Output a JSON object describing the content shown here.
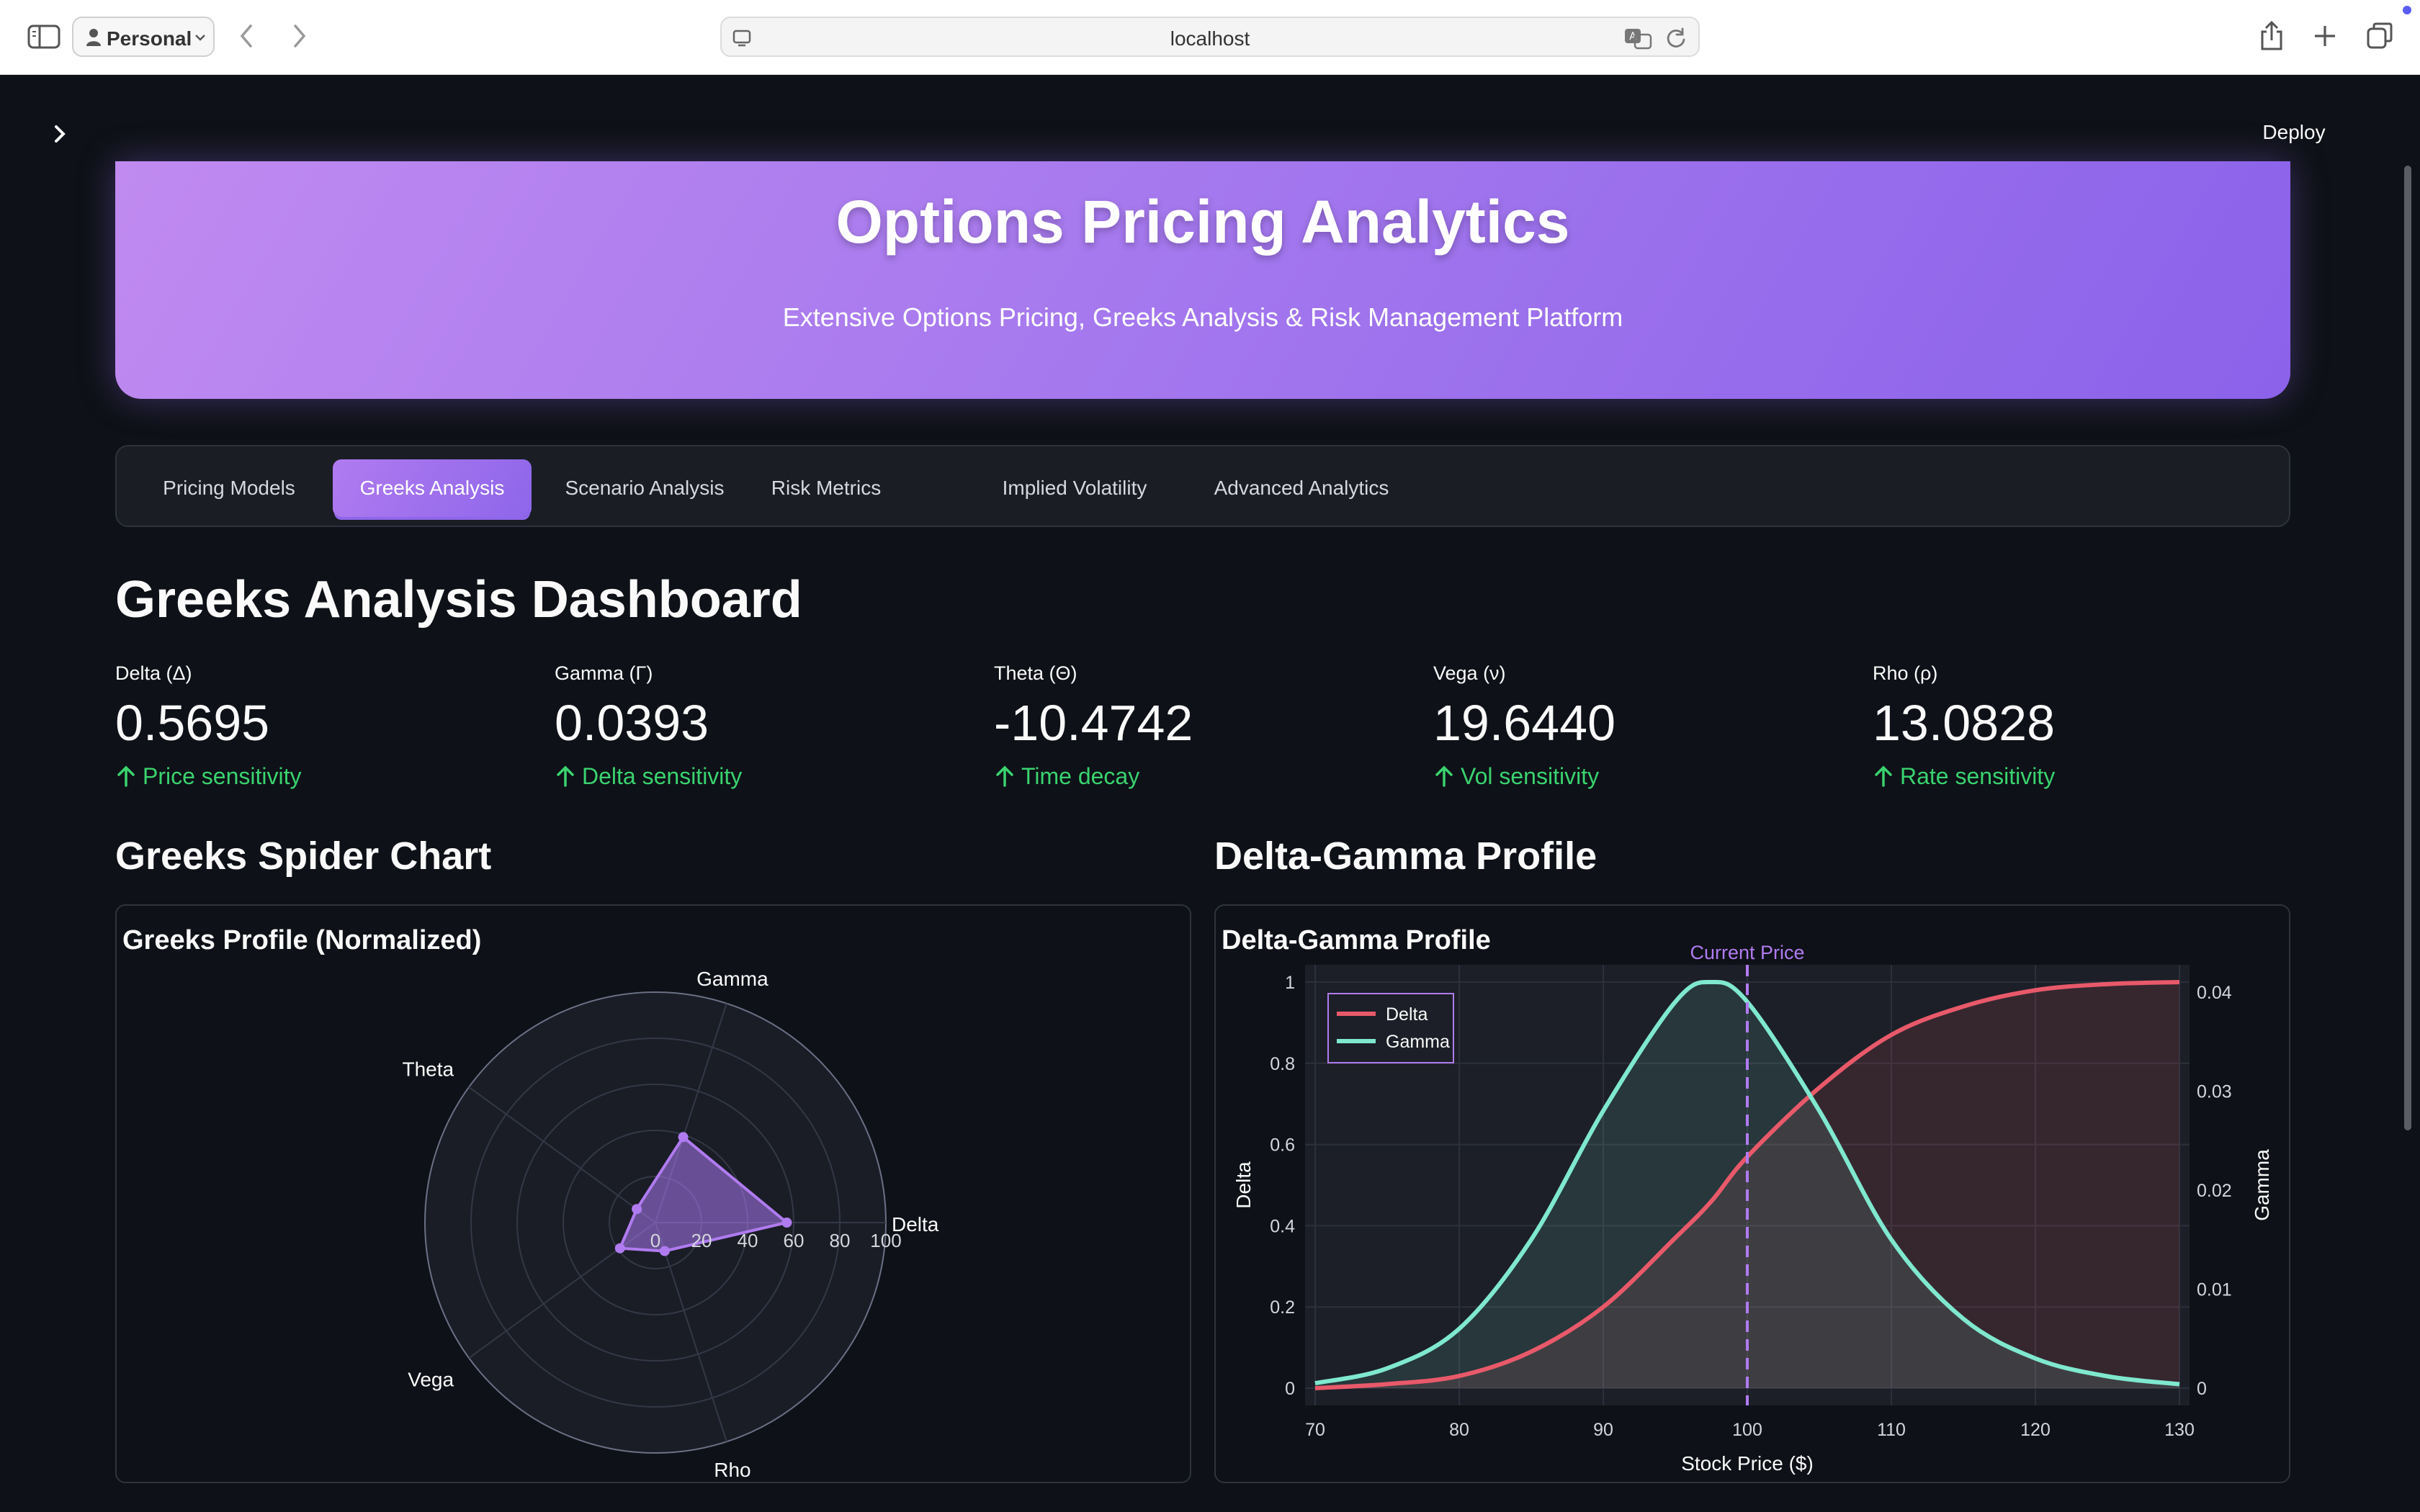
{
  "browser": {
    "profile_label": "Personal",
    "url": "localhost"
  },
  "app": {
    "deploy_label": "Deploy"
  },
  "hero": {
    "title": "Options Pricing Analytics",
    "subtitle": "Extensive Options Pricing, Greeks Analysis & Risk Management Platform"
  },
  "tabs": [
    {
      "label": "Pricing Models"
    },
    {
      "label": "Greeks Analysis"
    },
    {
      "label": "Scenario Analysis"
    },
    {
      "label": "Risk Metrics"
    },
    {
      "label": "Implied Volatility"
    },
    {
      "label": "Advanced Analytics"
    }
  ],
  "active_tab": "Greeks Analysis",
  "dashboard": {
    "title": "Greeks Analysis Dashboard",
    "metrics": [
      {
        "label": "Delta (Δ)",
        "value": "0.5695",
        "delta": "Price sensitivity"
      },
      {
        "label": "Gamma (Γ)",
        "value": "0.0393",
        "delta": "Delta sensitivity"
      },
      {
        "label": "Theta (Θ)",
        "value": "-10.4742",
        "delta": "Time decay"
      },
      {
        "label": "Vega (ν)",
        "value": "19.6440",
        "delta": "Vol sensitivity"
      },
      {
        "label": "Rho (ρ)",
        "value": "13.0828",
        "delta": "Rate sensitivity"
      }
    ],
    "spider_section_title": "Greeks Spider Chart",
    "profile_section_title": "Delta-Gamma Profile"
  },
  "colors": {
    "accent": "#a47cf0",
    "positive": "#3ad36f",
    "delta_line": "#e8596a",
    "gamma_line": "#7fe8cf",
    "background": "#0e1117"
  },
  "chart_data": [
    {
      "type": "radar",
      "title": "Greeks Profile (Normalized)",
      "axes": [
        "Delta",
        "Gamma",
        "Theta",
        "Vega",
        "Rho"
      ],
      "values": [
        57,
        39,
        10,
        19,
        13
      ],
      "radial_range": [
        0,
        100
      ],
      "radial_ticks": [
        "0",
        "20",
        "40",
        "60",
        "80",
        "100"
      ]
    },
    {
      "type": "line",
      "title": "Delta-Gamma Profile",
      "xlabel": "Stock Price ($)",
      "ylabel": "Delta",
      "y2label": "Gamma",
      "xlim": [
        70,
        130
      ],
      "ylim": [
        0,
        1
      ],
      "y2lim": [
        0,
        0.041
      ],
      "x_ticks": [
        "70",
        "80",
        "90",
        "100",
        "110",
        "120",
        "130"
      ],
      "y_ticks": [
        "0",
        "0.2",
        "0.4",
        "0.6",
        "0.8",
        "1"
      ],
      "y2_ticks": [
        "0",
        "0.01",
        "0.02",
        "0.03",
        "0.04"
      ],
      "x": [
        70,
        75,
        80,
        85,
        90,
        95,
        97.5,
        100,
        105,
        110,
        115,
        120,
        125,
        130
      ],
      "series": [
        {
          "name": "Delta",
          "axis": "y",
          "values": [
            0.0,
            0.01,
            0.03,
            0.09,
            0.2,
            0.37,
            0.46,
            0.57,
            0.74,
            0.87,
            0.94,
            0.98,
            0.995,
            1.0
          ]
        },
        {
          "name": "Gamma",
          "axis": "y2",
          "values": [
            0.0005,
            0.002,
            0.006,
            0.015,
            0.028,
            0.039,
            0.041,
            0.039,
            0.028,
            0.015,
            0.007,
            0.003,
            0.0012,
            0.0004
          ]
        }
      ],
      "vline": {
        "x": 100,
        "label": "Current Price"
      },
      "legend": "top-left"
    }
  ]
}
